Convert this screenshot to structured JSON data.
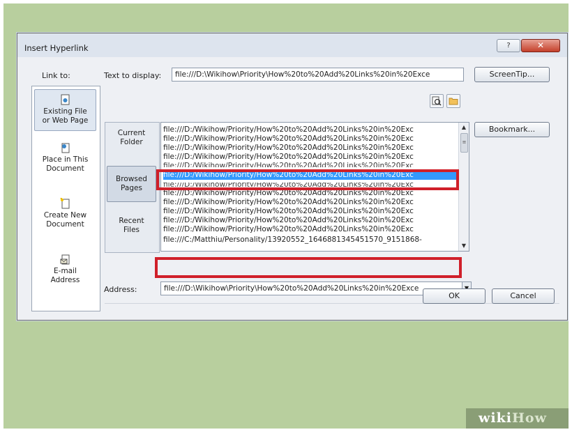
{
  "dialog": {
    "title": "Insert Hyperlink",
    "help_label": "?",
    "close_label": "✕"
  },
  "link_to": {
    "label": "Link to:",
    "items": [
      {
        "line1": "Existing File",
        "line2": "or Web Page",
        "icon": "web-page-icon"
      },
      {
        "line1": "Place in This",
        "line2": "Document",
        "icon": "place-in-document-icon"
      },
      {
        "line1": "Create New",
        "line2": "Document",
        "icon": "new-document-icon"
      },
      {
        "line1": "E-mail",
        "line2": "Address",
        "icon": "email-icon"
      }
    ]
  },
  "text_to_display": {
    "label": "Text to display:",
    "value": "file:///D:\\Wikihow\\Priority\\How%20to%20Add%20Links%20in%20Exce"
  },
  "buttons": {
    "screentip": "ScreenTip...",
    "bookmark": "Bookmark...",
    "ok": "OK",
    "cancel": "Cancel"
  },
  "toolbar": {
    "browse_web_icon": "browse-web-icon",
    "browse_file_icon": "folder-icon"
  },
  "look_in_tabs": [
    {
      "line1": "Current",
      "line2": "Folder"
    },
    {
      "line1": "Browsed",
      "line2": "Pages"
    },
    {
      "line1": "Recent",
      "line2": "Files"
    }
  ],
  "file_list": [
    "file:///D:/Wikihow/Priority/How%20to%20Add%20Links%20in%20Exc",
    "file:///D:/Wikihow/Priority/How%20to%20Add%20Links%20in%20Exc",
    "file:///D:/Wikihow/Priority/How%20to%20Add%20Links%20in%20Exc",
    "file:///D:/Wikihow/Priority/How%20to%20Add%20Links%20in%20Exc",
    "file:///D:/Wikihow/Priority/How%20to%20Add%20Links%20in%20Exc",
    "file:///D:/Wikihow/Priority/How%20to%20Add%20Links%20in%20Exc",
    "file:///D:/Wikihow/Priority/How%20to%20Add%20Links%20in%20Exc",
    "file:///D:/Wikihow/Priority/How%20to%20Add%20Links%20in%20Exc",
    "file:///D:/Wikihow/Priority/How%20to%20Add%20Links%20in%20Exc",
    "file:///D:/Wikihow/Priority/How%20to%20Add%20Links%20in%20Exc",
    "file:///D:/Wikihow/Priority/How%20to%20Add%20Links%20in%20Exc",
    "file:///D:/Wikihow/Priority/How%20to%20Add%20Links%20in%20Exc",
    "file:///C:/Matthiu/Personality/13920552_1646881345451570_9151868-"
  ],
  "address": {
    "label": "Address:",
    "value": "file:///D:\\Wikihow\\Priority\\How%20to%20Add%20Links%20in%20Exce"
  },
  "watermark": {
    "part1": "wiki",
    "part2": "How"
  },
  "colors": {
    "background": "#b8cf9e",
    "highlight": "#d0202a",
    "selection": "#3399ff"
  }
}
